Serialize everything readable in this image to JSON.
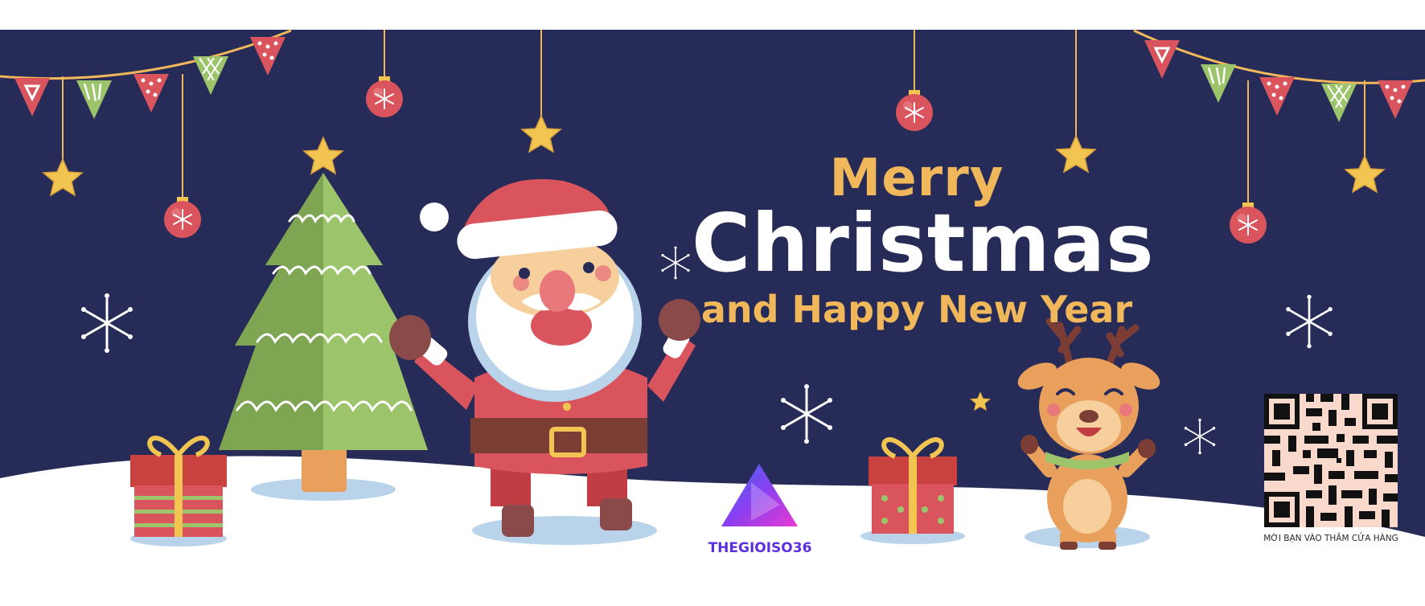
{
  "greeting": {
    "line1": "Merry",
    "line2": "Christmas",
    "line3": "and Happy New Year"
  },
  "brand": {
    "name": "THEGIOISO36"
  },
  "qr": {
    "caption": "MỜI BẠN VÀO THĂM CỬA HÀNG"
  },
  "colors": {
    "sky": "#262b57",
    "gold": "#f0b85a",
    "santa_red": "#d9545c",
    "tree_green": "#9cc46a",
    "snow": "#ffffff",
    "brand_purple": "#5b2ee0"
  },
  "icons": [
    "bunting-flags",
    "ornament-ball",
    "hanging-star",
    "snowflake",
    "christmas-tree",
    "santa",
    "reindeer",
    "gift-box",
    "qr-code",
    "triangle-play-logo"
  ]
}
